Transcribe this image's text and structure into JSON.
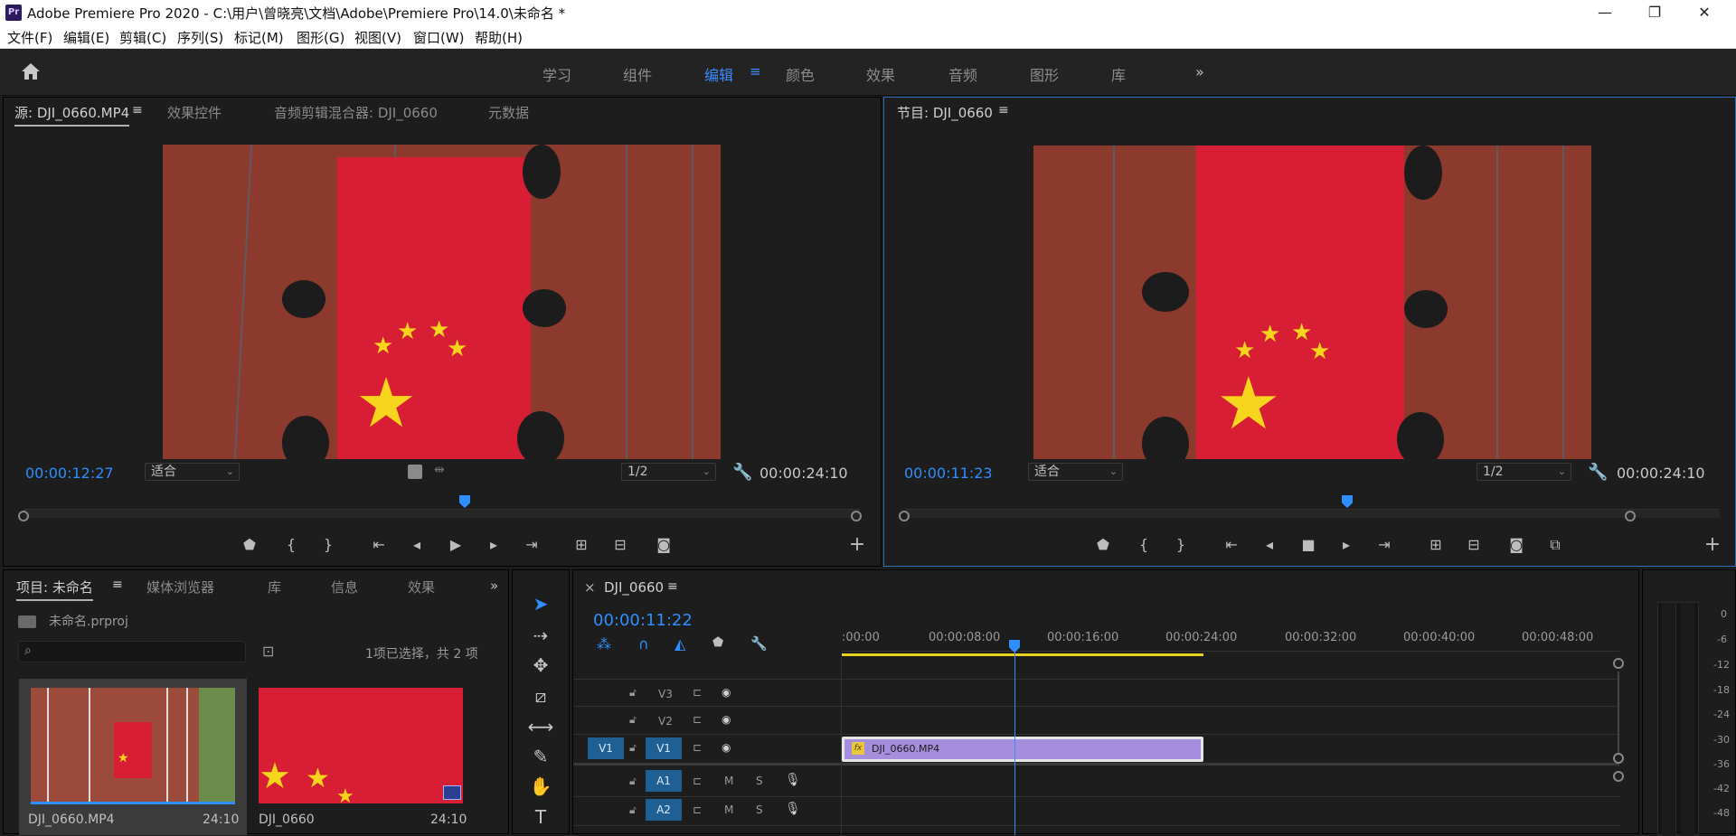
{
  "window": {
    "title": "Adobe Premiere Pro 2020 - C:\\用户\\曾晓亮\\文档\\Adobe\\Premiere Pro\\14.0\\未命名 *",
    "app_icon": "Pr",
    "minimize": "—",
    "maximize": "❐",
    "close": "✕"
  },
  "menu": [
    "文件(F)",
    "编辑(E)",
    "剪辑(C)",
    "序列(S)",
    "标记(M)",
    "图形(G)",
    "视图(V)",
    "窗口(W)",
    "帮助(H)"
  ],
  "workspaces": {
    "items": [
      "学习",
      "组件",
      "编辑",
      "颜色",
      "效果",
      "音频",
      "图形",
      "库"
    ],
    "active": "编辑",
    "more": "»",
    "menu_icon": "≡"
  },
  "source_monitor": {
    "tabs": [
      "源: DJI_0660.MP4",
      "效果控件",
      "音频剪辑混合器: DJI_0660",
      "元数据"
    ],
    "tab_menu": "≡",
    "timecode": "00:00:12:27",
    "fit": "适合",
    "resolution": "1/2",
    "duration": "00:00:24:10",
    "add": "+"
  },
  "program_monitor": {
    "tab": "节目: DJI_0660",
    "tab_menu": "≡",
    "timecode": "00:00:11:23",
    "fit": "适合",
    "resolution": "1/2",
    "duration": "00:00:24:10",
    "add": "+"
  },
  "project": {
    "tabs": [
      "项目: 未命名",
      "媒体浏览器",
      "库",
      "信息",
      "效果"
    ],
    "tab_menu": "≡",
    "more": "»",
    "file": "未命名.prproj",
    "selection_info": "1项已选择，共 2 项",
    "search_placeholder": "",
    "items": [
      {
        "name": "DJI_0660.MP4",
        "duration": "24:10"
      },
      {
        "name": "DJI_0660",
        "duration": "24:10"
      }
    ]
  },
  "timeline": {
    "close": "×",
    "sequence": "DJI_0660",
    "tab_menu": "≡",
    "timecode": "00:00:11:22",
    "ruler": [
      ":00:00",
      "00:00:08:00",
      "00:00:16:00",
      "00:00:24:00",
      "00:00:32:00",
      "00:00:40:00",
      "00:00:48:00"
    ],
    "video_tracks": [
      "V3",
      "V2",
      "V1"
    ],
    "audio_tracks": [
      "A1",
      "A2"
    ],
    "source_patch_video": "V1",
    "source_patch_audio": "A1",
    "source_patch_audio2": "A2",
    "clip": {
      "name": "DJI_0660.MP4",
      "fx": "fx"
    },
    "mute": "M",
    "solo": "S"
  },
  "audio_meter": {
    "labels": [
      "0",
      "-6",
      "-12",
      "-18",
      "-24",
      "-30",
      "-36",
      "-42",
      "-48"
    ]
  },
  "colors": {
    "accent": "#2f8fff",
    "clip": "#a58fdc",
    "track_target": "#1f5f93",
    "work_area": "#e6d31e"
  }
}
